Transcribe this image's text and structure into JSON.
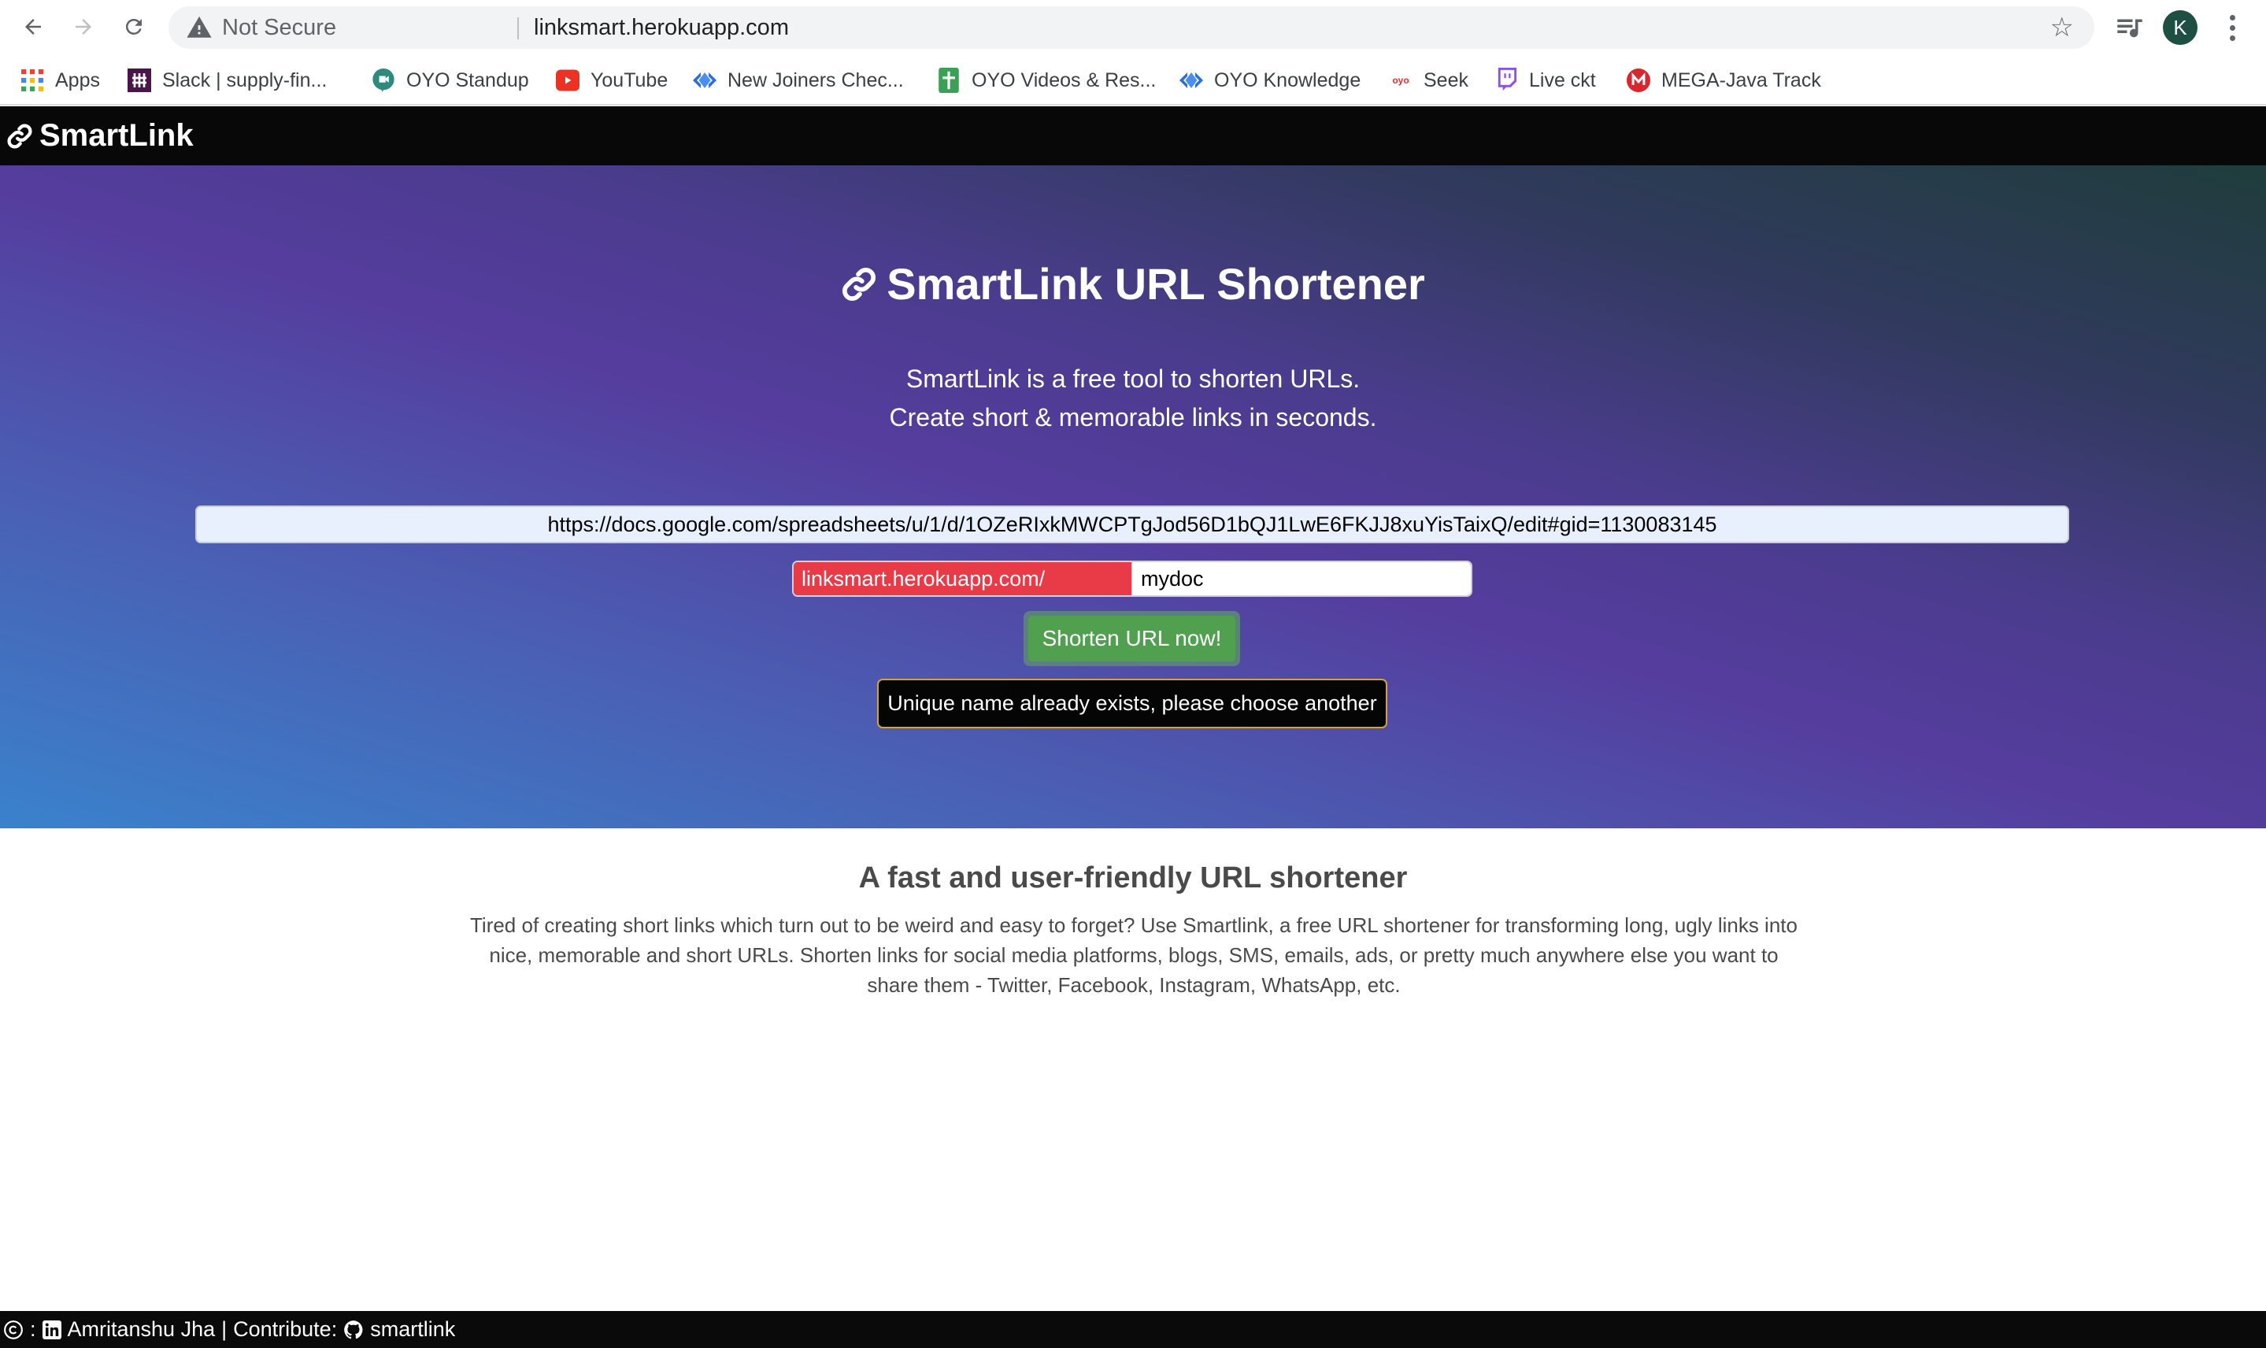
{
  "browser": {
    "security_label": "Not Secure",
    "url": "linksmart.herokuapp.com",
    "profile_initial": "K",
    "profile_color": "#1d4f43",
    "bookmarks": [
      {
        "label": "Apps",
        "icon": "apps-grid-icon"
      },
      {
        "label": "Slack | supply-fin...",
        "icon": "slack-icon"
      },
      {
        "label": "OYO Standup",
        "icon": "google-meet-icon"
      },
      {
        "label": "YouTube",
        "icon": "youtube-icon"
      },
      {
        "label": "New Joiners Chec...",
        "icon": "confluence-icon"
      },
      {
        "label": "OYO Videos & Res...",
        "icon": "google-sheets-icon"
      },
      {
        "label": "OYO Knowledge",
        "icon": "confluence-icon"
      },
      {
        "label": "Seek",
        "icon": "oyo-icon"
      },
      {
        "label": "Live ckt",
        "icon": "twitch-icon"
      },
      {
        "label": "MEGA-Java Track",
        "icon": "mega-icon"
      }
    ]
  },
  "app": {
    "brand": "SmartLink"
  },
  "hero": {
    "title": "SmartLink URL Shortener",
    "subtitle_line1": "SmartLink is a free tool to shorten URLs.",
    "subtitle_line2": "Create short & memorable links in seconds.",
    "long_url_value": "https://docs.google.com/spreadsheets/u/1/d/1OZeRIxkMWCPTgJod56D1bQJ1LwE6FKJJ8xuYisTaixQ/edit#gid=1130083145",
    "alias_prefix": "linksmart.herokuapp.com/",
    "alias_value": "mydoc",
    "shorten_button": "Shorten URL now!",
    "error_message": "Unique name already exists, please choose another",
    "colors": {
      "prefix_bg": "#e83a47",
      "button_bg": "#51a050",
      "error_border": "#d4a23a"
    }
  },
  "info": {
    "title": "A fast and user-friendly URL shortener",
    "text": "Tired of creating short links which turn out to be weird and easy to forget? Use Smartlink, a free URL shortener for transforming long, ugly links into nice, memorable and short URLs. Shorten links for social media platforms, blogs, SMS, emails, ads, or pretty much anywhere else you want to share them - Twitter, Facebook, Instagram, WhatsApp, etc."
  },
  "footer": {
    "copyright_sep": ":",
    "author": "Amritanshu Jha",
    "divider": "|",
    "contribute_label": "Contribute:",
    "repo": "smartlink"
  }
}
